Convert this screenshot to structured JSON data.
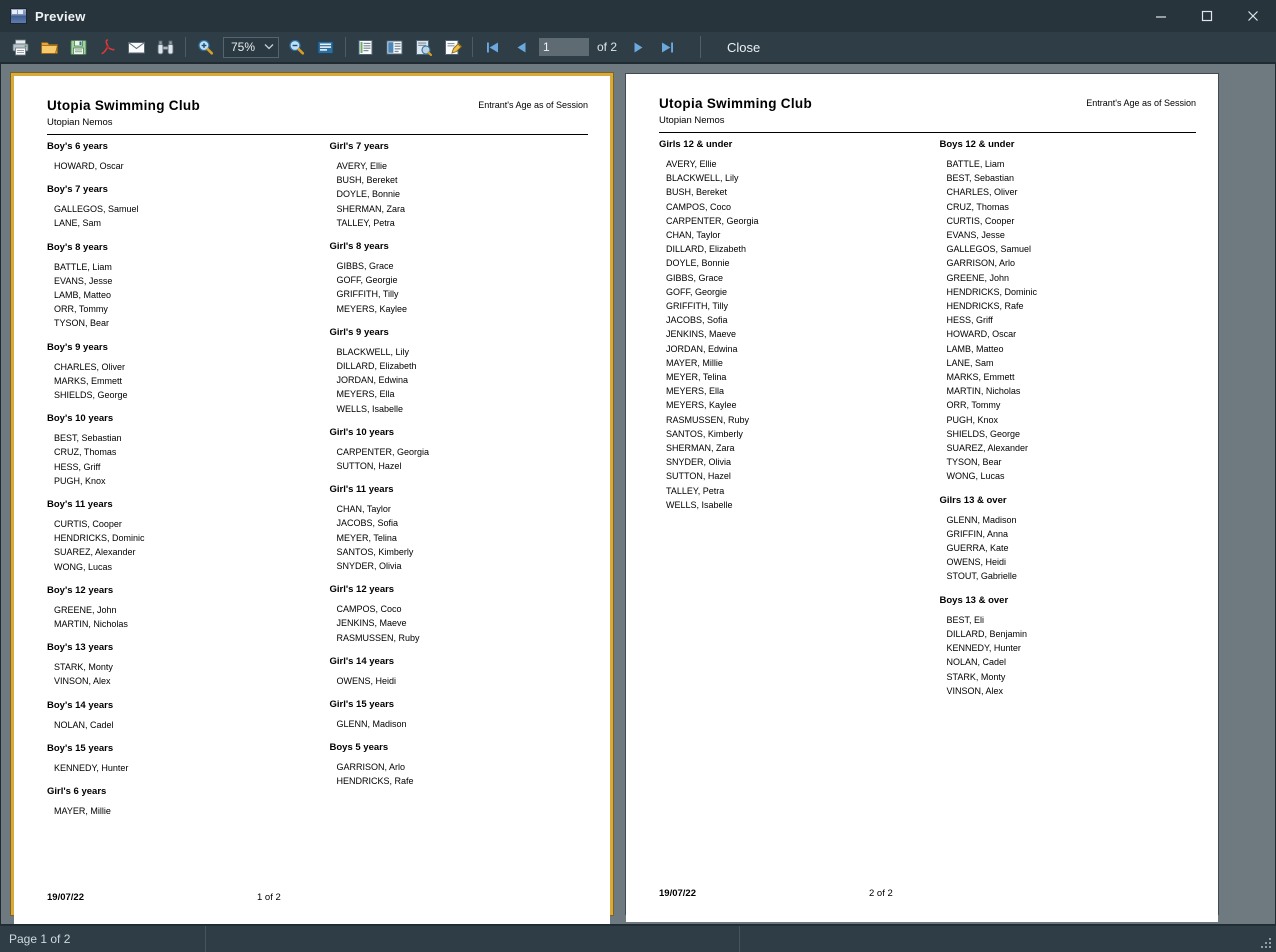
{
  "window": {
    "title": "Preview",
    "icon": "preview-app-icon",
    "controls": {
      "minimize": "minimize-icon",
      "maximize": "maximize-icon",
      "close": "close-icon"
    }
  },
  "toolbar": {
    "buttons": [
      {
        "name": "print-icon",
        "title": "Print"
      },
      {
        "name": "open-folder-icon",
        "title": "Open"
      },
      {
        "name": "save-icon",
        "title": "Save"
      },
      {
        "name": "pdf-export-icon",
        "title": "Export to PDF"
      },
      {
        "name": "email-icon",
        "title": "Send by Email"
      },
      {
        "name": "find-binoculars-icon",
        "title": "Find"
      }
    ],
    "zoom_in": "zoom-in-icon",
    "zoom_out": "zoom-out-icon",
    "zoom_value": "75%",
    "zoom_caret": "chevron-down-icon",
    "page_view": "page-view-icon",
    "view_buttons": [
      {
        "name": "single-page-layout-icon",
        "title": "Single page layout"
      },
      {
        "name": "two-page-layout-icon",
        "title": "Two page layout"
      },
      {
        "name": "page-setup-icon",
        "title": "Page setup"
      },
      {
        "name": "edit-report-icon",
        "title": "Edit"
      }
    ],
    "nav": {
      "first": "first-page-icon",
      "prev": "previous-page-icon",
      "page_value": "1",
      "of_label": "of 2",
      "next": "next-page-icon",
      "last": "last-page-icon"
    },
    "close_label": "Close"
  },
  "statusbar": {
    "page_status": "Page 1 of 2",
    "grip": "resize-grip-icon"
  },
  "report": {
    "club": "Utopia Swimming Club",
    "subtitle": "Utopian Nemos",
    "as_of": "Entrant's Age as of Session",
    "date": "19/07/22"
  },
  "pages": [
    {
      "selected": true,
      "page_label": "1 of 2",
      "columns": [
        {
          "groups": [
            {
              "title": "Boy's 6 years",
              "names": [
                "HOWARD, Oscar"
              ]
            },
            {
              "title": "Boy's 7 years",
              "names": [
                "GALLEGOS, Samuel",
                "LANE, Sam"
              ]
            },
            {
              "title": "Boy's 8 years",
              "names": [
                "BATTLE, Liam",
                "EVANS, Jesse",
                "LAMB, Matteo",
                "ORR, Tommy",
                "TYSON, Bear"
              ]
            },
            {
              "title": "Boy's 9 years",
              "names": [
                "CHARLES, Oliver",
                "MARKS, Emmett",
                "SHIELDS, George"
              ]
            },
            {
              "title": "Boy's 10 years",
              "names": [
                "BEST, Sebastian",
                "CRUZ, Thomas",
                "HESS, Griff",
                "PUGH, Knox"
              ]
            },
            {
              "title": "Boy's 11 years",
              "names": [
                "CURTIS, Cooper",
                "HENDRICKS, Dominic",
                "SUAREZ, Alexander",
                "WONG, Lucas"
              ]
            },
            {
              "title": "Boy's 12 years",
              "names": [
                "GREENE, John",
                "MARTIN, Nicholas"
              ]
            },
            {
              "title": "Boy's 13 years",
              "names": [
                "STARK, Monty",
                "VINSON, Alex"
              ]
            },
            {
              "title": "Boy's 14 years",
              "names": [
                "NOLAN, Cadel"
              ]
            },
            {
              "title": "Boy's 15 years",
              "names": [
                "KENNEDY, Hunter"
              ]
            },
            {
              "title": "Girl's 6 years",
              "names": [
                "MAYER, Millie"
              ]
            }
          ]
        },
        {
          "groups": [
            {
              "title": "Girl's 7 years",
              "names": [
                "AVERY, Ellie",
                "BUSH, Bereket",
                "DOYLE, Bonnie",
                "SHERMAN, Zara",
                "TALLEY, Petra"
              ]
            },
            {
              "title": "Girl's 8 years",
              "names": [
                "GIBBS, Grace",
                "GOFF, Georgie",
                "GRIFFITH, Tilly",
                "MEYERS, Kaylee"
              ]
            },
            {
              "title": "Girl's 9 years",
              "names": [
                "BLACKWELL, Lily",
                "DILLARD, Elizabeth",
                "JORDAN, Edwina",
                "MEYERS, Ella",
                "WELLS, Isabelle"
              ]
            },
            {
              "title": "Girl's 10 years",
              "names": [
                "CARPENTER, Georgia",
                "SUTTON, Hazel"
              ]
            },
            {
              "title": "Girl's 11 years",
              "names": [
                "CHAN, Taylor",
                "JACOBS, Sofia",
                "MEYER, Telina",
                "SANTOS, Kimberly",
                "SNYDER, Olivia"
              ]
            },
            {
              "title": "Girl's 12 years",
              "names": [
                "CAMPOS, Coco",
                "JENKINS, Maeve",
                "RASMUSSEN, Ruby"
              ]
            },
            {
              "title": "Girl's 14 years",
              "names": [
                "OWENS, Heidi"
              ]
            },
            {
              "title": "Girl's 15 years",
              "names": [
                "GLENN, Madison"
              ]
            },
            {
              "title": "Boys 5 years",
              "names": [
                "GARRISON, Arlo",
                "HENDRICKS, Rafe"
              ]
            }
          ]
        }
      ]
    },
    {
      "selected": false,
      "page_label": "2 of 2",
      "columns": [
        {
          "groups": [
            {
              "title": "Girls 12 & under",
              "names": [
                "AVERY, Ellie",
                "BLACKWELL, Lily",
                "BUSH, Bereket",
                "CAMPOS, Coco",
                "CARPENTER, Georgia",
                "CHAN, Taylor",
                "DILLARD, Elizabeth",
                "DOYLE, Bonnie",
                "GIBBS, Grace",
                "GOFF, Georgie",
                "GRIFFITH, Tilly",
                "JACOBS, Sofia",
                "JENKINS, Maeve",
                "JORDAN, Edwina",
                "MAYER, Millie",
                "MEYER, Telina",
                "MEYERS, Ella",
                "MEYERS, Kaylee",
                "RASMUSSEN, Ruby",
                "SANTOS, Kimberly",
                "SHERMAN, Zara",
                "SNYDER, Olivia",
                "SUTTON, Hazel",
                "TALLEY, Petra",
                "WELLS, Isabelle"
              ]
            }
          ]
        },
        {
          "groups": [
            {
              "title": "Boys 12 & under",
              "names": [
                "BATTLE, Liam",
                "BEST, Sebastian",
                "CHARLES, Oliver",
                "CRUZ, Thomas",
                "CURTIS, Cooper",
                "EVANS, Jesse",
                "GALLEGOS, Samuel",
                "GARRISON, Arlo",
                "GREENE, John",
                "HENDRICKS, Dominic",
                "HENDRICKS, Rafe",
                "HESS, Griff",
                "HOWARD, Oscar",
                "LAMB, Matteo",
                "LANE, Sam",
                "MARKS, Emmett",
                "MARTIN, Nicholas",
                "ORR, Tommy",
                "PUGH, Knox",
                "SHIELDS, George",
                "SUAREZ, Alexander",
                "TYSON, Bear",
                "WONG, Lucas"
              ]
            },
            {
              "title": "Gilrs 13 & over",
              "names": [
                "GLENN, Madison",
                "GRIFFIN, Anna",
                "GUERRA, Kate",
                "OWENS, Heidi",
                "STOUT, Gabrielle"
              ]
            },
            {
              "title": "Boys 13 & over",
              "names": [
                "BEST, Eli",
                "DILLARD, Benjamin",
                "KENNEDY, Hunter",
                "NOLAN, Cadel",
                "STARK, Monty",
                "VINSON, Alex"
              ]
            }
          ]
        }
      ]
    }
  ],
  "colors": {
    "titlebar": "#27343c",
    "toolbar": "#2e3d46",
    "canvas": "#6e7a80",
    "selection_border": "#d9a93a",
    "page": "#ffffff",
    "text_light": "#e6ecef"
  }
}
